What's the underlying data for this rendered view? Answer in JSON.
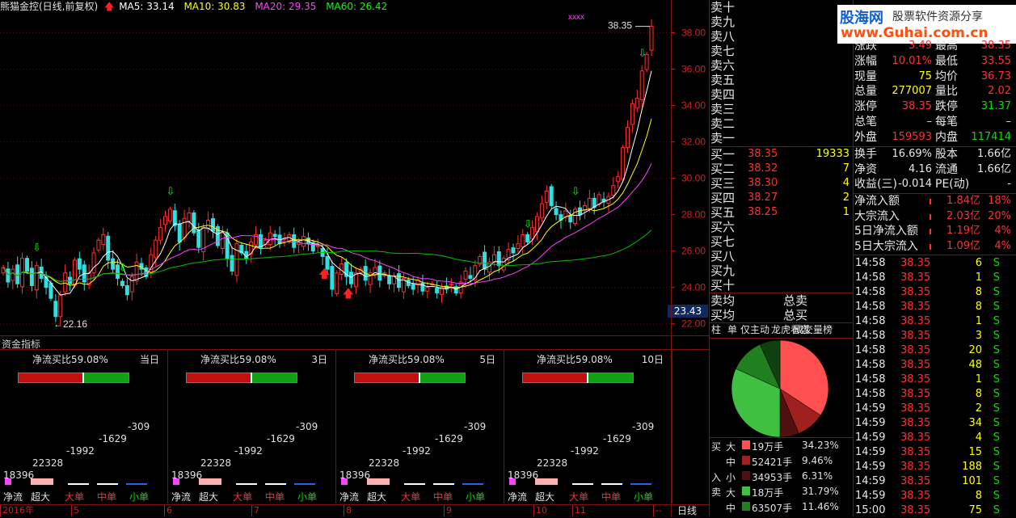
{
  "header": {
    "title": "熊猫金控(日线,前复权)",
    "ma5": "MA5: 33.14",
    "ma10": "MA10: 30.83",
    "ma20": "MA20: 29.35",
    "ma60": "MA60: 26.42"
  },
  "chart_data": {
    "type": "candlestick",
    "ylim": [
      21.5,
      39.0
    ],
    "y_ticks": [
      "38.00",
      "36.00",
      "34.00",
      "32.00",
      "30.00",
      "28.00",
      "26.00",
      "24.00",
      "22.00"
    ],
    "annotations": {
      "high": "38.35",
      "low": "22.16",
      "current": "23.43",
      "marker": "xxxx"
    },
    "x_labels": [
      "2016年",
      "5",
      "6",
      "7",
      "8",
      "9",
      "10",
      "11",
      "--"
    ],
    "closes": [
      25.1,
      24.3,
      25.0,
      24.2,
      25.6,
      24.9,
      24.1,
      25.2,
      24.5,
      24.0,
      23.4,
      22.4,
      23.6,
      24.8,
      24.2,
      25.5,
      25.0,
      24.3,
      24.8,
      25.9,
      26.6,
      26.9,
      25.5,
      25.0,
      24.5,
      24.1,
      23.6,
      24.6,
      25.4,
      25.0,
      24.6,
      25.8,
      26.6,
      27.3,
      27.9,
      28.3,
      27.4,
      26.5,
      27.8,
      28.1,
      27.0,
      26.2,
      27.3,
      27.7,
      27.1,
      26.3,
      27.0,
      25.6,
      24.9,
      26.4,
      25.9,
      25.6,
      26.5,
      26.9,
      26.2,
      26.6,
      27.0,
      26.8,
      26.4,
      26.7,
      26.9,
      26.2,
      26.5,
      26.8,
      26.4,
      26.0,
      26.3,
      25.7,
      25.0,
      23.9,
      24.8,
      25.3,
      24.6,
      24.2,
      24.8,
      25.0,
      24.4,
      24.8,
      25.1,
      24.4,
      24.8,
      24.2,
      24.6,
      24.0,
      24.5,
      24.1,
      23.9,
      24.4,
      23.8,
      24.0,
      24.2,
      23.7,
      24.0,
      23.9,
      24.2,
      23.7,
      24.3,
      24.9,
      24.5,
      25.2,
      25.7,
      25.0,
      25.4,
      25.8,
      25.2,
      25.6,
      26.1,
      25.9,
      26.4,
      26.9,
      26.5,
      27.3,
      27.9,
      28.6,
      29.3,
      28.5,
      28.0,
      27.7,
      28.2,
      27.6,
      28.3,
      28.0,
      28.5,
      28.9,
      28.4,
      29.1,
      28.7,
      29.0,
      29.6,
      30.1,
      31.7,
      32.8,
      34.1,
      34.4,
      35.9,
      36.8,
      38.35
    ],
    "fund_panels": [
      {
        "period": "当日",
        "ratio": "净流买比59.08%",
        "labels": [
          "18396",
          "22328",
          "-1992",
          "-1629",
          "-309"
        ]
      },
      {
        "period": "3日",
        "ratio": "净流买比59.08%",
        "labels": [
          "18396",
          "22328",
          "-1992",
          "-1629",
          "-309"
        ]
      },
      {
        "period": "5日",
        "ratio": "净流买比59.08%",
        "labels": [
          "18396",
          "22328",
          "-1992",
          "-1629",
          "-309"
        ]
      },
      {
        "period": "10日",
        "ratio": "净流买比59.08%",
        "labels": [
          "18396",
          "22328",
          "-1992",
          "-1629",
          "-309"
        ]
      }
    ],
    "fund_categories": [
      "净流",
      "超大",
      "大单",
      "中单",
      "小单"
    ],
    "pie": {
      "slices": [
        {
          "label": "买大",
          "pct": 34.23
        },
        {
          "label": "买中",
          "pct": 9.46
        },
        {
          "label": "买小",
          "pct": 6.31
        },
        {
          "label": "卖大",
          "pct": 31.79
        },
        {
          "label": "卖中",
          "pct": 11.46
        },
        {
          "label": "卖小",
          "pct": 6.75
        }
      ]
    }
  },
  "fund_title": "资金指标",
  "period_tab": "日线",
  "order_book": {
    "sell": [
      "卖十",
      "卖九",
      "卖八",
      "卖七",
      "卖六",
      "卖五",
      "卖四",
      "卖三",
      "卖二",
      "卖一"
    ],
    "buy": [
      {
        "label": "买一",
        "price": "38.35",
        "vol": "19333"
      },
      {
        "label": "买二",
        "price": "38.32",
        "vol": "7"
      },
      {
        "label": "买三",
        "price": "38.30",
        "vol": "4"
      },
      {
        "label": "买四",
        "price": "38.27",
        "vol": "2"
      },
      {
        "label": "买五",
        "price": "38.25",
        "vol": "1"
      },
      {
        "label": "买六",
        "price": "",
        "vol": ""
      },
      {
        "label": "买七",
        "price": "",
        "vol": ""
      },
      {
        "label": "买八",
        "price": "",
        "vol": ""
      },
      {
        "label": "买九",
        "price": "",
        "vol": ""
      },
      {
        "label": "买十",
        "price": "",
        "vol": ""
      }
    ],
    "avg_sell": "卖均",
    "avg_buy": "买均",
    "total_sell": "总卖",
    "total_buy": "总买"
  },
  "tabs": [
    "柱",
    "单",
    "仅主动",
    "龙虎看盘",
    "成交量榜"
  ],
  "watermark": {
    "brand": "股海网",
    "slogan": "股票软件资源分享",
    "url": "www.Guhai.com.cn"
  },
  "quote_stats": [
    [
      "涨跌",
      "3.49",
      "最高",
      "38.35"
    ],
    [
      "涨幅",
      "10.01%",
      "最低",
      "33.55"
    ],
    [
      "现量",
      "75",
      "均价",
      "36.73"
    ],
    [
      "总量",
      "277007",
      "量比",
      "2.02"
    ],
    [
      "涨停",
      "38.35",
      "跌停",
      "31.37"
    ],
    [
      "总笔",
      "–",
      "每笔",
      "–"
    ],
    [
      "外盘",
      "159593",
      "内盘",
      "117414"
    ]
  ],
  "fin_stats": [
    [
      "换手",
      "16.69%",
      "股本",
      "1.66亿"
    ],
    [
      "净资",
      "4.16",
      "流通",
      "1.66亿"
    ],
    [
      "收益(三)",
      "-0.014",
      "PE(动)",
      "-"
    ]
  ],
  "flow_stats": [
    [
      "净流入额",
      "1.84亿",
      "18%"
    ],
    [
      "大宗流入",
      "2.03亿",
      "20%"
    ],
    [
      "5日净流入额",
      "1.19亿",
      "4%"
    ],
    [
      "5日大宗流入",
      "1.09亿",
      "4%"
    ]
  ],
  "deal_table": {
    "headers": [
      "净流",
      "超大",
      "大单",
      "中单",
      "小单"
    ],
    "rows": [
      [
        "大",
        "19万手",
        "34.23%"
      ],
      [
        "中",
        "52421手",
        "9.46%"
      ],
      [
        "小",
        "34953手",
        "6.31%"
      ],
      [
        "大",
        "18万手",
        "31.79%"
      ],
      [
        "中",
        "63507手",
        "11.46%"
      ]
    ],
    "side_buy": "买",
    "side_in": "入",
    "side_sell": "卖"
  },
  "ticks": [
    [
      "14:58",
      "38.35",
      "6",
      "S"
    ],
    [
      "14:58",
      "38.35",
      "1",
      "S"
    ],
    [
      "14:58",
      "38.35",
      "8",
      "S"
    ],
    [
      "14:58",
      "38.35",
      "8",
      "S"
    ],
    [
      "14:58",
      "38.35",
      "1",
      "S"
    ],
    [
      "14:58",
      "38.35",
      "3",
      "S"
    ],
    [
      "14:58",
      "38.35",
      "20",
      "S"
    ],
    [
      "14:58",
      "38.35",
      "48",
      "S"
    ],
    [
      "14:58",
      "38.35",
      "1",
      "S"
    ],
    [
      "14:58",
      "38.35",
      "8",
      "S"
    ],
    [
      "14:59",
      "38.35",
      "2",
      "S"
    ],
    [
      "14:59",
      "38.35",
      "34",
      "S"
    ],
    [
      "14:59",
      "38.35",
      "4",
      "S"
    ],
    [
      "14:59",
      "38.35",
      "15",
      "S"
    ],
    [
      "14:59",
      "38.35",
      "188",
      "S"
    ],
    [
      "14:59",
      "38.35",
      "101",
      "S"
    ],
    [
      "14:59",
      "38.35",
      "8",
      "S"
    ],
    [
      "15:00",
      "38.35",
      "75",
      "S"
    ]
  ]
}
